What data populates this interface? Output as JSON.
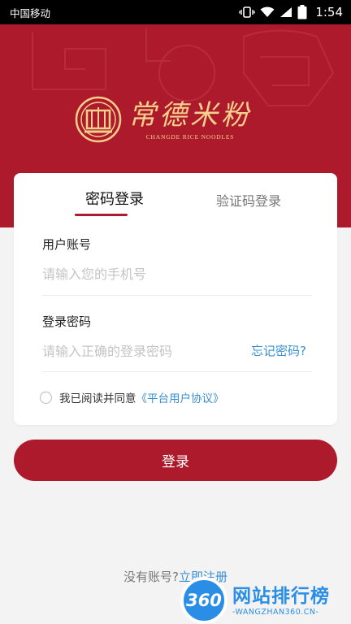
{
  "status_bar": {
    "carrier": "中国移动",
    "battery_level": "79",
    "time": "1:54"
  },
  "brand": {
    "name_cn": "常德米粉",
    "name_en": "CHANGDE RICE NOODLES",
    "primary_color": "#ad1a2b",
    "accent_gold": "#f5d08c"
  },
  "tabs": [
    {
      "label": "密码登录",
      "active": true
    },
    {
      "label": "验证码登录",
      "active": false
    }
  ],
  "form": {
    "account_label": "用户账号",
    "account_placeholder": "请输入您的手机号",
    "password_label": "登录密码",
    "password_placeholder": "请输入正确的登录密码",
    "forgot_label": "忘记密码?",
    "agree_text": "我已阅读并同意",
    "agreement_link": "《平台用户协议》",
    "agreed": false
  },
  "login_button": "登录",
  "register": {
    "prompt": "没有账号?",
    "link": "立即注册"
  },
  "watermark": {
    "badge": "360",
    "title": "网站排行榜",
    "subtitle": "-WANGZHAN360.CN-"
  },
  "icons": {
    "status": [
      "vibrate-icon",
      "wifi-icon",
      "signal-icon",
      "battery-icon"
    ],
    "logo": "noodle-bowl-logo-icon"
  },
  "link_color": "#3a8fd1"
}
